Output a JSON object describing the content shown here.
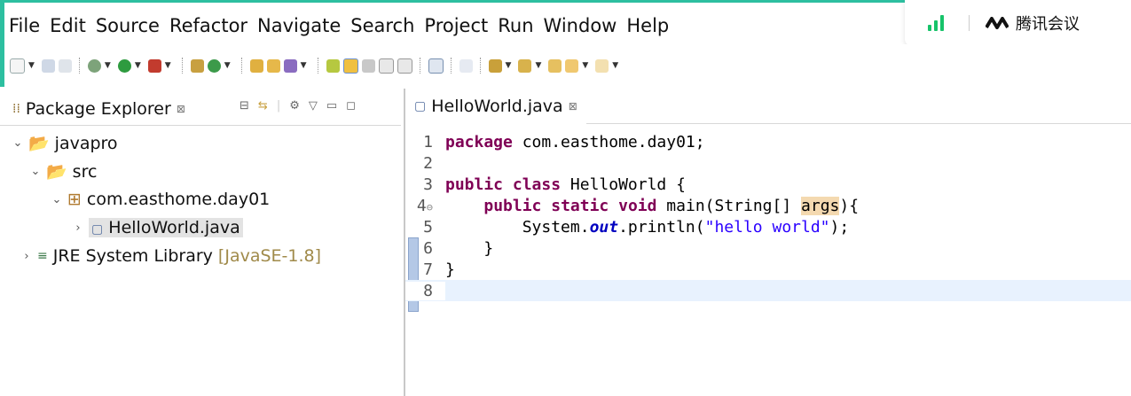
{
  "menu": [
    "File",
    "Edit",
    "Source",
    "Refactor",
    "Navigate",
    "Search",
    "Project",
    "Run",
    "Window",
    "Help"
  ],
  "meeting": {
    "app_name": "腾讯会议",
    "signal_color": "#17c36a"
  },
  "package_explorer": {
    "title": "Package Explorer",
    "close_glyph": "⊠",
    "tree": [
      {
        "label": "javapro",
        "icon": "project-folder-icon",
        "twist": "⌄"
      },
      {
        "label": "src",
        "icon": "source-folder-icon",
        "twist": "⌄"
      },
      {
        "label": "com.easthome.day01",
        "icon": "package-icon",
        "twist": "⌄"
      },
      {
        "label": "HelloWorld.java",
        "icon": "java-file-icon",
        "twist": "›"
      },
      {
        "label": "JRE System Library",
        "version": "[JavaSE-1.8]",
        "icon": "library-icon",
        "twist": "›"
      }
    ]
  },
  "editor": {
    "tab_label": "HelloWorld.java",
    "close_glyph": "⊠",
    "lines": [
      {
        "n": "1",
        "fold": ""
      },
      {
        "n": "2",
        "fold": ""
      },
      {
        "n": "3",
        "fold": ""
      },
      {
        "n": "4",
        "fold": "⊖"
      },
      {
        "n": "5",
        "fold": ""
      },
      {
        "n": "6",
        "fold": ""
      },
      {
        "n": "7",
        "fold": ""
      },
      {
        "n": "8",
        "fold": ""
      }
    ],
    "code": {
      "l1_kw": "package",
      "l1_rest": " com.easthome.day01;",
      "l3_kw1": "public",
      "l3_kw2": "class",
      "l3_rest": " HelloWorld {",
      "l4_kw1": "public",
      "l4_kw2": "static",
      "l4_kw3": "void",
      "l4_mid": " main(String[] ",
      "l4_arg": "args",
      "l4_end": "){",
      "l5_pre": "System.",
      "l5_field": "out",
      "l5_mid": ".println(",
      "l5_str": "\"hello world\"",
      "l5_end": ");",
      "l6": "}",
      "l7": "}"
    }
  }
}
